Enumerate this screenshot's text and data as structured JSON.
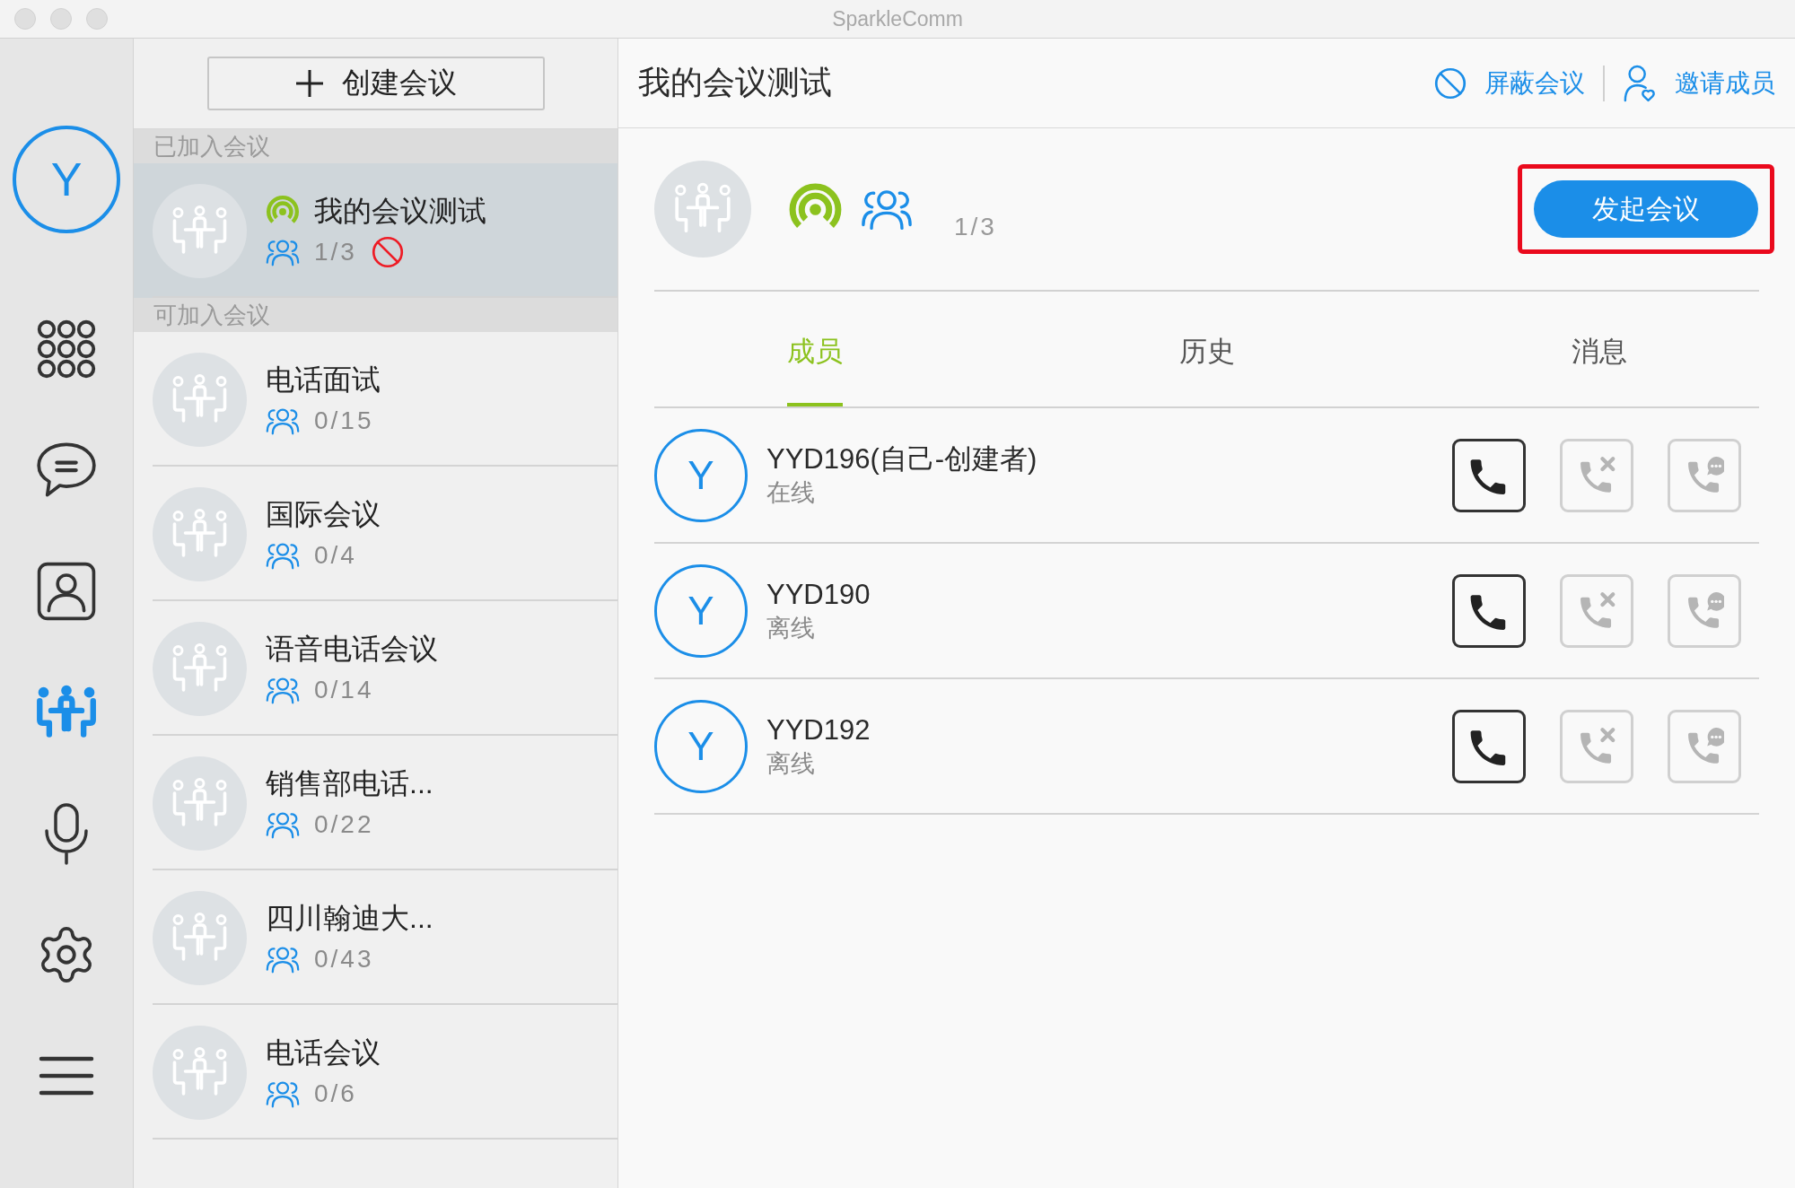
{
  "window": {
    "title": "SparkleComm"
  },
  "nav": {
    "avatar": "Y",
    "items": [
      {
        "kind": "dialpad",
        "selected": false
      },
      {
        "kind": "chat",
        "selected": false
      },
      {
        "kind": "contacts",
        "selected": false
      },
      {
        "kind": "meetings",
        "selected": true
      },
      {
        "kind": "microphone",
        "selected": false
      },
      {
        "kind": "settings",
        "selected": false
      },
      {
        "kind": "menu",
        "selected": false
      }
    ]
  },
  "meeting_list": {
    "create_button": "创建会议",
    "sections": [
      {
        "heading": "已加入会议",
        "meetings": [
          {
            "name": "我的会议测试",
            "count": "1/3",
            "live": true,
            "blocked": true,
            "selected": true
          }
        ]
      },
      {
        "heading": "可加入会议",
        "meetings": [
          {
            "name": "电话面试",
            "count": "0/15",
            "live": false,
            "blocked": false,
            "selected": false
          },
          {
            "name": "国际会议",
            "count": "0/4",
            "live": false,
            "blocked": false,
            "selected": false
          },
          {
            "name": "语音电话会议",
            "count": "0/14",
            "live": false,
            "blocked": false,
            "selected": false
          },
          {
            "name": "销售部电话...",
            "count": "0/22",
            "live": false,
            "blocked": false,
            "selected": false
          },
          {
            "name": "四川翰迪大...",
            "count": "0/43",
            "live": false,
            "blocked": false,
            "selected": false
          },
          {
            "name": "电话会议",
            "count": "0/6",
            "live": false,
            "blocked": false,
            "selected": false
          }
        ]
      }
    ]
  },
  "detail": {
    "title": "我的会议测试",
    "header_actions": [
      {
        "kind": "block",
        "label": "屏蔽会议"
      },
      {
        "kind": "invite",
        "label": "邀请成员"
      }
    ],
    "live": true,
    "count": "1/3",
    "start_button": {
      "label": "发起会议",
      "highlighted": true
    },
    "tabs": [
      {
        "label": "成员",
        "selected": true
      },
      {
        "label": "历史",
        "selected": false
      },
      {
        "label": "消息",
        "selected": false
      }
    ],
    "members": [
      {
        "avatar": "Y",
        "name": "YYD196(自己-创建者)",
        "status": "在线",
        "actions": [
          {
            "kind": "call",
            "disabled": false
          },
          {
            "kind": "hangup",
            "disabled": true
          },
          {
            "kind": "message",
            "disabled": true
          }
        ]
      },
      {
        "avatar": "Y",
        "name": "YYD190",
        "status": "离线",
        "actions": [
          {
            "kind": "call",
            "disabled": false
          },
          {
            "kind": "hangup",
            "disabled": true
          },
          {
            "kind": "message",
            "disabled": true
          }
        ]
      },
      {
        "avatar": "Y",
        "name": "YYD192",
        "status": "离线",
        "actions": [
          {
            "kind": "call",
            "disabled": false
          },
          {
            "kind": "hangup",
            "disabled": true
          },
          {
            "kind": "message",
            "disabled": true
          }
        ]
      }
    ]
  }
}
